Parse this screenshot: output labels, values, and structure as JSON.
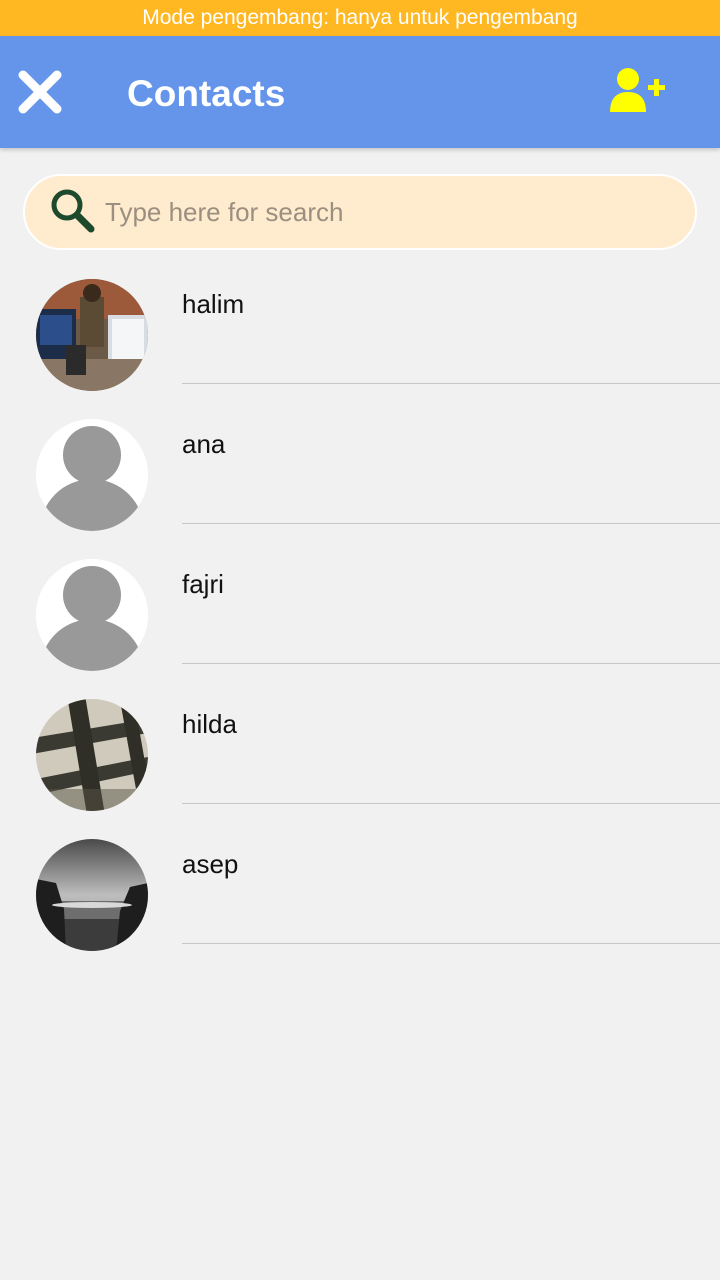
{
  "status_bar": {
    "dev_mode_text": "Mode pengembang: hanya untuk pengembang"
  },
  "header": {
    "close_icon": "close-icon",
    "title": "Contacts",
    "add_icon": "add-person-icon"
  },
  "search": {
    "placeholder": "Type here for search",
    "value": "",
    "icon": "search-icon"
  },
  "contacts": [
    {
      "name": "halim",
      "avatar": "photo-person-laptops"
    },
    {
      "name": "ana",
      "avatar": "default-person-silhouette"
    },
    {
      "name": "fajri",
      "avatar": "default-person-silhouette"
    },
    {
      "name": "hilda",
      "avatar": "photo-metal-grate"
    },
    {
      "name": "asep",
      "avatar": "photo-beach-grayscale"
    }
  ],
  "colors": {
    "dev_bar": "#ffb722",
    "app_bar": "#6495ea",
    "add_icon": "#ffff00",
    "search_bg": "#ffebcd",
    "search_icon": "#1d4a2c",
    "background": "#f1f1f1"
  }
}
